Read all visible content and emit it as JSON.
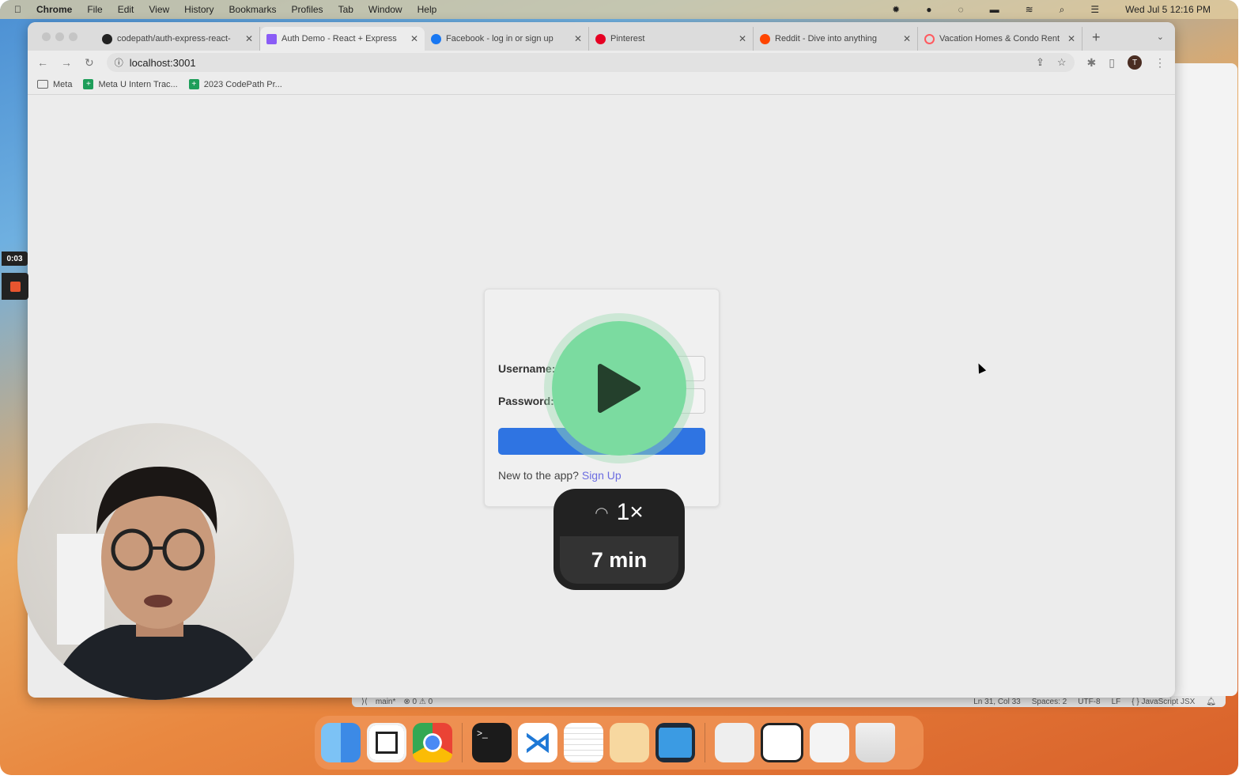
{
  "menubar": {
    "items": [
      "Chrome",
      "File",
      "Edit",
      "View",
      "History",
      "Bookmarks",
      "Profiles",
      "Tab",
      "Window",
      "Help"
    ],
    "clock": "Wed Jul 5  12:16 PM"
  },
  "tabs": [
    {
      "title": "codepath/auth-express-react-",
      "icon": "github-icon",
      "color": "#222222",
      "active": false
    },
    {
      "title": "Auth Demo - React + Express",
      "icon": "vite-icon",
      "color": "#8a5cf6",
      "active": true
    },
    {
      "title": "Facebook - log in or sign up",
      "icon": "facebook-icon",
      "color": "#1877f2",
      "active": false
    },
    {
      "title": "Pinterest",
      "icon": "pinterest-icon",
      "color": "#e60023",
      "active": false
    },
    {
      "title": "Reddit - Dive into anything",
      "icon": "reddit-icon",
      "color": "#ff4500",
      "active": false
    },
    {
      "title": "Vacation Homes & Condo Rent",
      "icon": "airbnb-icon",
      "color": "#ff5a5f",
      "active": false
    }
  ],
  "address": {
    "url": "localhost:3001"
  },
  "profile": {
    "initial": "T"
  },
  "bookmarks": [
    "Meta",
    "Meta U Intern Trac...",
    "2023 CodePath Pr..."
  ],
  "login": {
    "username_label": "Username:",
    "password_label": "Password:",
    "signup_prompt": "New to the app?",
    "signup_link": "Sign Up"
  },
  "player": {
    "speed": "1×",
    "duration": "7 min",
    "elapsed": "0:03"
  },
  "vscode_status": {
    "branch": "main*",
    "problems": "⊗ 0 ⚠ 0",
    "position": "Ln 31, Col 33",
    "spaces": "Spaces: 2",
    "encoding": "UTF-8",
    "eol": "LF",
    "language": "{ } JavaScript JSX"
  },
  "colors": {
    "accent": "#2f74e2",
    "play": "#7bdba0",
    "link": "#6b6ce0"
  }
}
